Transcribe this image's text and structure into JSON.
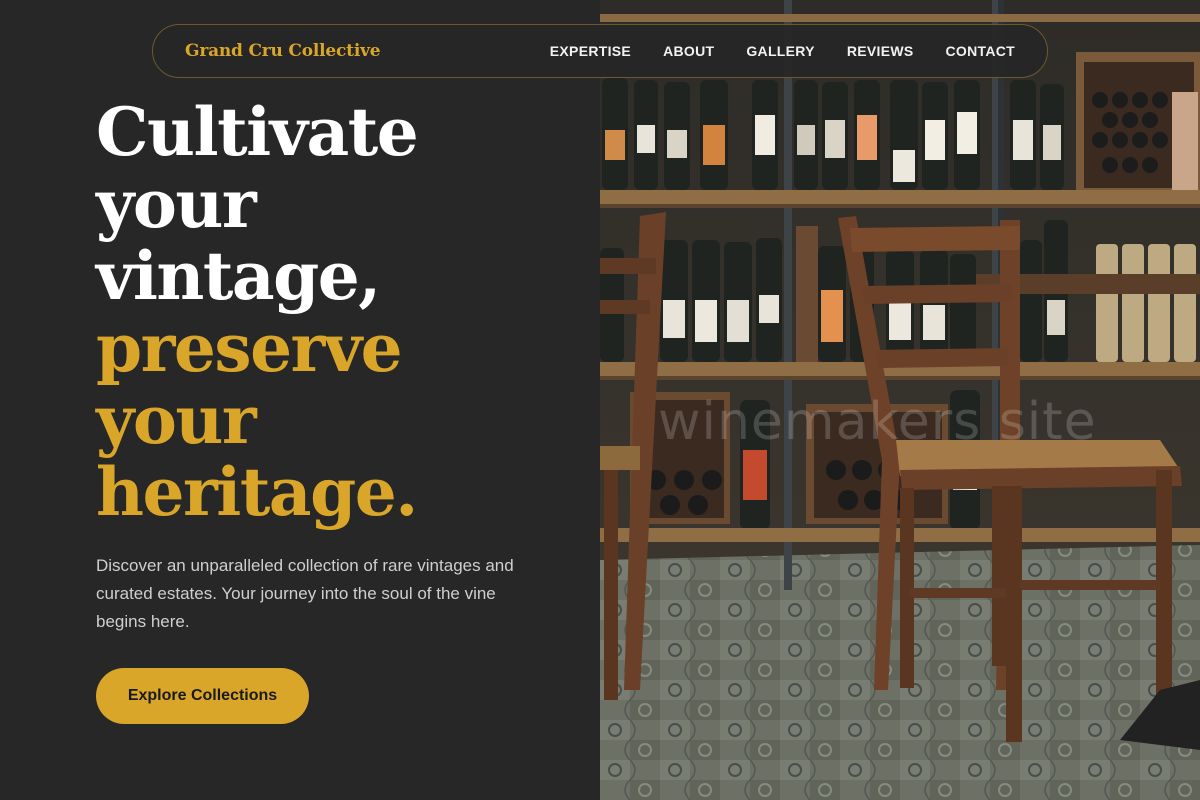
{
  "nav": {
    "brand": "Grand Cru Collective",
    "links": [
      "EXPERTISE",
      "ABOUT",
      "GALLERY",
      "REVIEWS",
      "CONTACT"
    ]
  },
  "hero": {
    "headline_white": [
      "Cultivate",
      "your",
      "vintage,"
    ],
    "headline_gold": [
      "preserve",
      "your",
      "heritage."
    ],
    "description": "Discover an unparalleled collection of rare vintages and curated estates. Your journey into the soul of the vine begins here.",
    "cta_label": "Explore Collections"
  },
  "image": {
    "alt": "Wine shop interior with bottle shelves and wooden chairs",
    "watermark": "winemakers site"
  },
  "colors": {
    "accent": "#d9a62a",
    "background": "#272727",
    "text_light": "#ffffff",
    "text_muted": "#cfcfcf"
  }
}
